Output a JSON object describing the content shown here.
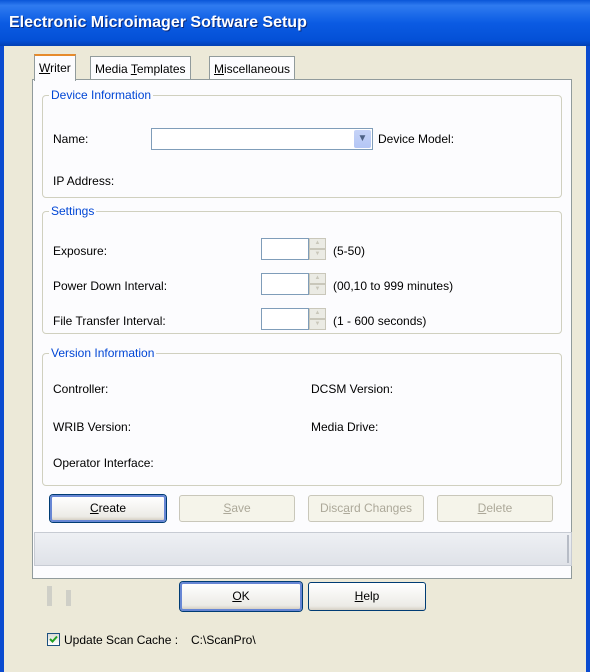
{
  "window": {
    "title": "Electronic Microimager Software Setup"
  },
  "tabs": [
    {
      "pre": "",
      "key": "W",
      "post": "riter",
      "active": true
    },
    {
      "pre": "Media ",
      "key": "T",
      "post": "emplates",
      "active": false
    },
    {
      "pre": "",
      "key": "M",
      "post": "iscellaneous",
      "active": false
    }
  ],
  "device_info": {
    "legend": "Device Information",
    "name_label": "Name:",
    "name_value": "",
    "model_label": "Device Model:",
    "ip_label": "IP Address:"
  },
  "settings": {
    "legend": "Settings",
    "exposure_label": "Exposure:",
    "exposure_value": "",
    "exposure_range": "(5-50)",
    "power_label": "Power Down Interval:",
    "power_value": "",
    "power_range": "(00,10 to 999 minutes)",
    "transfer_label": "File Transfer Interval:",
    "transfer_value": "",
    "transfer_range": "(1 - 600 seconds)"
  },
  "version_info": {
    "legend": "Version Information",
    "controller_label": "Controller:",
    "dcsm_label": "DCSM Version:",
    "wrib_label": "WRIB Version:",
    "media_label": "Media Drive:",
    "operator_label": "Operator Interface:"
  },
  "actions": {
    "create": {
      "key": "C",
      "rest": "reate"
    },
    "save": {
      "key": "S",
      "rest": "ave"
    },
    "discard": {
      "pre": "Disc",
      "key": "a",
      "rest": "rd Changes"
    },
    "delete": {
      "key": "D",
      "rest": "elete"
    }
  },
  "dialog": {
    "ok": {
      "key": "O",
      "rest": "K"
    },
    "help": {
      "key": "H",
      "rest": "elp"
    }
  },
  "footer": {
    "update_cache_label": "Update Scan Cache :",
    "update_cache_checked": true,
    "cache_path": "C:\\ScanPro\\"
  }
}
